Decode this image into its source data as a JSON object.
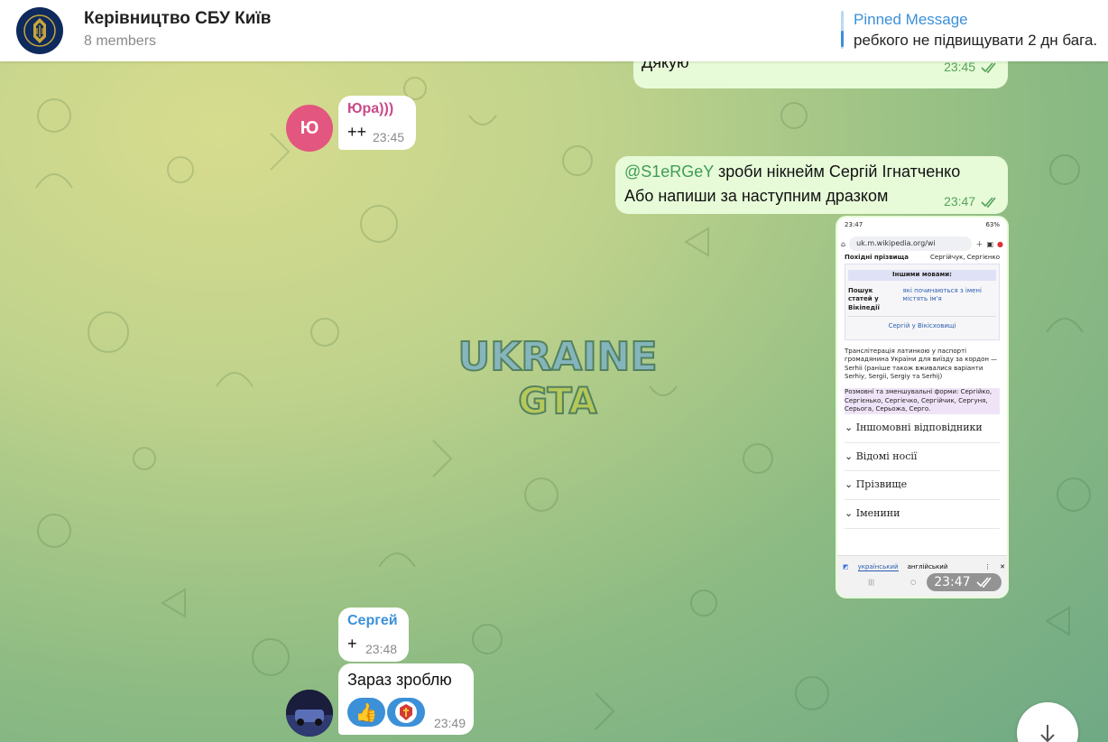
{
  "header": {
    "title": "Керівництво СБУ Київ",
    "members": "8 members",
    "pinned_label": "Pinned Message",
    "pinned_text": "ребкого не підвищувати 2 дн бага."
  },
  "messages": [
    {
      "id": "m1",
      "text": "Дякую",
      "time": "23:45",
      "outgoing": true
    },
    {
      "id": "m2",
      "sender": "Юра)))",
      "avatar_letter": "Ю",
      "text": "++",
      "time": "23:45",
      "outgoing": false
    },
    {
      "id": "m3",
      "mention": "@S1eRGeY",
      "line1_rest": " зроби нікнейм Сергій Ігнатченко",
      "line2": "Або напиши за наступним дразком",
      "time": "23:47",
      "outgoing": true
    },
    {
      "id": "m4",
      "type": "image",
      "time": "23:47",
      "outgoing": true
    },
    {
      "id": "m5",
      "sender": "Сергей",
      "text": "+",
      "time": "23:48",
      "outgoing": false
    },
    {
      "id": "m6",
      "text": "Зараз зроблю",
      "time": "23:49",
      "outgoing": false,
      "reactions": [
        "👍",
        "🇺🇦"
      ]
    }
  ],
  "screenshot": {
    "status_time": "23:47",
    "status_right": "63%",
    "url": "uk.m.wikipedia.org/wi",
    "row1_label": "Похідні прізвища",
    "row1_value": "Сергійчук, Сергієнко",
    "other_langs": "Іншими мовами:",
    "search_label": "Пошук статей у Вікіпедії",
    "search_value": "які починаються з імені містять ім'я",
    "commons": "Сергій у Вікісховищі",
    "translit": "Транслітерація латинкою у паспорті громадянина України для виїзду за кордон — Serhii (раніше також вживалися варіанти Serhiy, Sergii, Sergiy та Serhij)",
    "forms": "Розмовні та зменшувальні форми: Сергійко, Сергієнько, Сергієчко, Сергійчик, Сергуня, Серьога, Серьожа, Серго.",
    "sections": [
      "Іншомовні відповідники",
      "Відомі носії",
      "Прізвище",
      "Іменини"
    ],
    "translate_from": "український",
    "translate_to": "англійський"
  },
  "colors": {
    "accent": "#3b90d8",
    "outgoing_bubble": "#e7fbd8",
    "sender_yura": "#c94a8a",
    "sender_sergey": "#3b90d8",
    "avatar_yura": "#e3567f"
  }
}
